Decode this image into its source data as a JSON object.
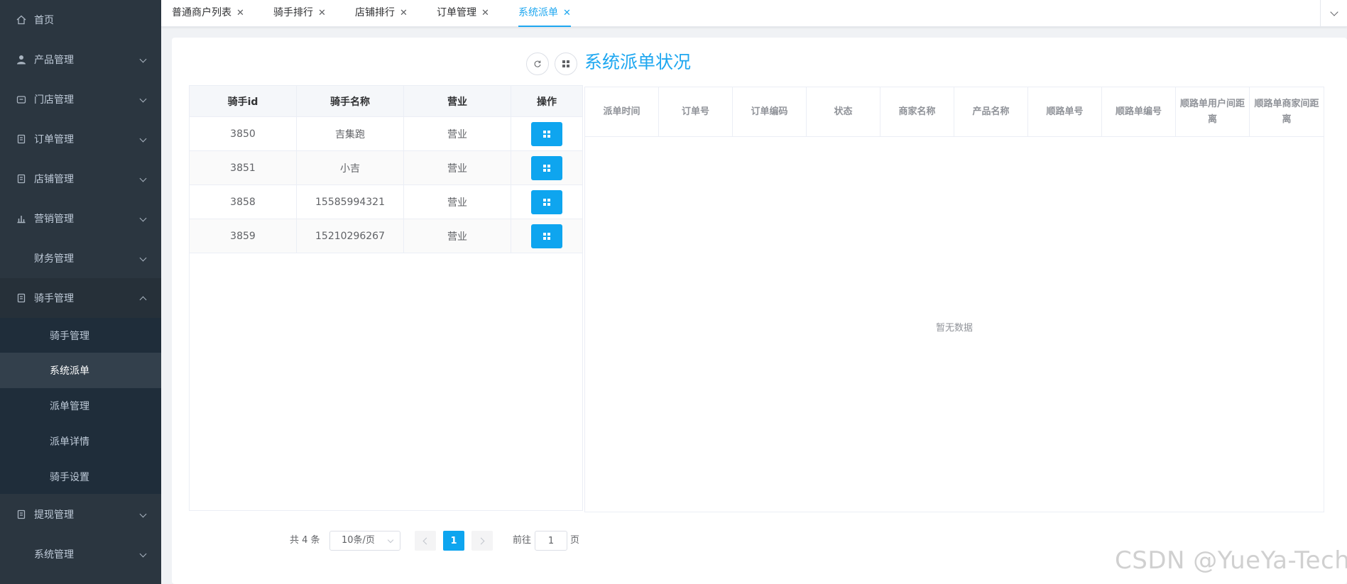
{
  "sidebar": {
    "items": [
      {
        "label": "首页",
        "icon": "home-icon"
      },
      {
        "label": "产品管理",
        "icon": "user-icon"
      },
      {
        "label": "门店管理",
        "icon": "shop-icon"
      },
      {
        "label": "订单管理",
        "icon": "document-icon"
      },
      {
        "label": "店铺管理",
        "icon": "document-icon"
      },
      {
        "label": "营销管理",
        "icon": "chart-icon"
      },
      {
        "label": "财务管理",
        "icon": ""
      },
      {
        "label": "骑手管理",
        "icon": "document-icon"
      },
      {
        "label": "提现管理",
        "icon": "document-icon"
      },
      {
        "label": "系统管理",
        "icon": ""
      }
    ],
    "submenu": [
      {
        "label": "骑手管理"
      },
      {
        "label": "系统派单"
      },
      {
        "label": "派单管理"
      },
      {
        "label": "派单详情"
      },
      {
        "label": "骑手设置"
      }
    ]
  },
  "tabs": [
    {
      "label": "普通商户列表"
    },
    {
      "label": "骑手排行"
    },
    {
      "label": "店铺排行"
    },
    {
      "label": "订单管理"
    },
    {
      "label": "系统派单"
    }
  ],
  "heading": "系统派单状况",
  "rider_table": {
    "columns": [
      "骑手id",
      "骑手名称",
      "营业",
      "操作"
    ],
    "rows": [
      {
        "id": "3850",
        "name": "吉集跑",
        "status": "营业"
      },
      {
        "id": "3851",
        "name": "小吉",
        "status": "营业"
      },
      {
        "id": "3858",
        "name": "15585994321",
        "status": "营业"
      },
      {
        "id": "3859",
        "name": "15210296267",
        "status": "营业"
      }
    ]
  },
  "order_table": {
    "columns": [
      "派单时间",
      "订单号",
      "订单编码",
      "状态",
      "商家名称",
      "产品名称",
      "顺路单号",
      "顺路单编号",
      "顺路单用户间距离",
      "顺路单商家间距离"
    ],
    "empty_text": "暂无数据"
  },
  "pagination": {
    "total": "共 4 条",
    "page_size": "10条/页",
    "current_page": "1",
    "goto_label": "前往",
    "goto_value": "1",
    "unit": "页"
  },
  "watermark": "CSDN @YueYa-Tech",
  "colors": {
    "sidebar_bg": "#2b3640",
    "accent": "#1ea7f0",
    "button": "#0ea5ef"
  }
}
